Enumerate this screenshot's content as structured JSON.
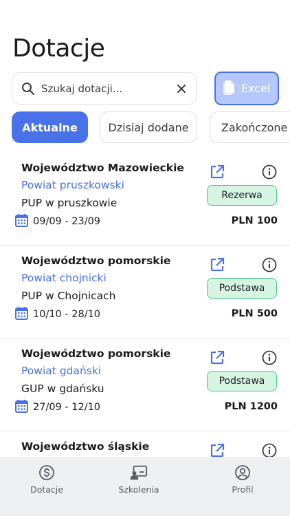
{
  "header": {
    "title": "Dotacje"
  },
  "search": {
    "placeholder": "Szukaj dotacji..."
  },
  "toolbar": {
    "excel_label": "Excel"
  },
  "filters": [
    {
      "label": "Aktualne",
      "active": true
    },
    {
      "label": "Dzisiaj dodane",
      "active": false
    },
    {
      "label": "Zakończone",
      "active": false
    }
  ],
  "colors": {
    "accent": "#4a72e8",
    "badge_bg": "#d5f5e2",
    "badge_border": "#4cc88a",
    "tabbar_bg": "#eeeff1"
  },
  "cards": [
    {
      "region": "Województwo Mazowieckie",
      "county": "Powiat pruszkowski",
      "office": "PUP w pruszkowie",
      "dates": "09/09 - 23/09",
      "badge": "Rezerwa",
      "amount": "PLN 100"
    },
    {
      "region": "Województwo pomorskie",
      "county": "Powiat chojnicki",
      "office": "PUP w Chojnicach",
      "dates": "10/10 - 28/10",
      "badge": "Podstawa",
      "amount": "PLN 500"
    },
    {
      "region": "Województwo pomorskie",
      "county": "Powiat gdański",
      "office": "GUP w gdańsku",
      "dates": "27/09 - 12/10",
      "badge": "Podstawa",
      "amount": "PLN 1200"
    },
    {
      "region": "Województwo śląskie",
      "county": "",
      "office": "",
      "dates": "",
      "badge": "",
      "amount": ""
    }
  ],
  "tabbar": [
    {
      "label": "Dotacje",
      "icon": "dollar-circle-icon"
    },
    {
      "label": "Szkolenia",
      "icon": "presentation-icon"
    },
    {
      "label": "Profil",
      "icon": "user-circle-icon"
    }
  ]
}
